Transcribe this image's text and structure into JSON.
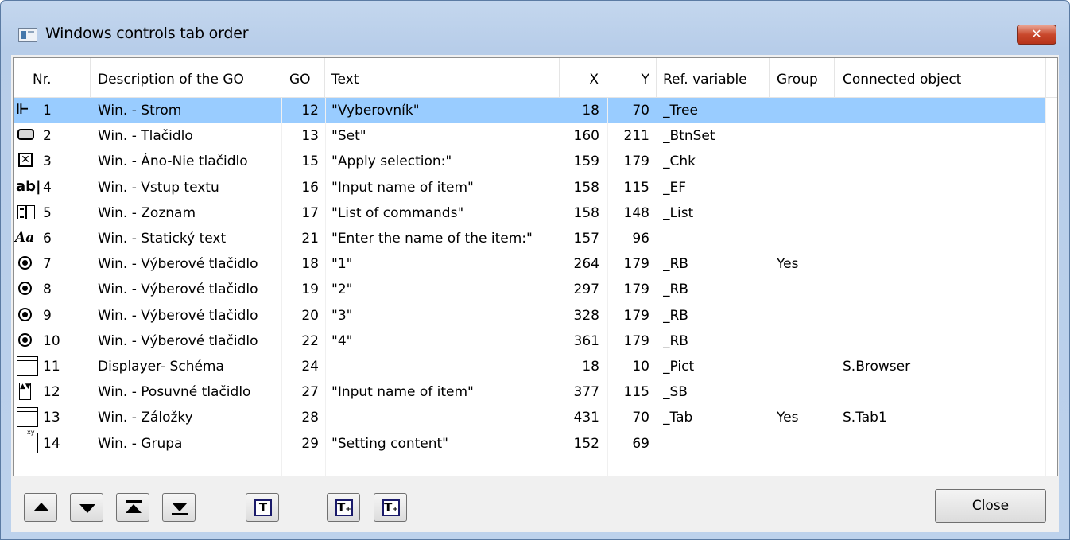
{
  "window": {
    "title": "Windows controls tab order",
    "close_glyph": "x"
  },
  "columns": {
    "nr": "Nr.",
    "desc": "Description of the GO",
    "go": "GO",
    "text": "Text",
    "x": "X",
    "y": "Y",
    "ref": "Ref. variable",
    "group": "Group",
    "conn": "Connected object"
  },
  "rows": [
    {
      "icon": "tree-icon",
      "nr": "1",
      "desc": "Win. - Strom",
      "go": "12",
      "text": "\"Vyberovník\"",
      "x": "18",
      "y": "70",
      "ref": "_Tree",
      "group": "",
      "conn": "",
      "selected": true
    },
    {
      "icon": "button-icon",
      "nr": "2",
      "desc": "Win. - Tlačidlo",
      "go": "13",
      "text": "\"Set\"",
      "x": "160",
      "y": "211",
      "ref": "_BtnSet",
      "group": "",
      "conn": ""
    },
    {
      "icon": "checkbox-icon",
      "nr": "3",
      "desc": "Win. - Áno-Nie tlačidlo",
      "go": "15",
      "text": "\"Apply selection:\"",
      "x": "159",
      "y": "179",
      "ref": "_Chk",
      "group": "",
      "conn": ""
    },
    {
      "icon": "text-input-icon",
      "nr": "4",
      "desc": "Win. - Vstup textu",
      "go": "16",
      "text": "\"Input name of item\"",
      "x": "158",
      "y": "115",
      "ref": "_EF",
      "group": "",
      "conn": ""
    },
    {
      "icon": "list-icon",
      "nr": "5",
      "desc": "Win. - Zoznam",
      "go": "17",
      "text": "\"List of commands\"",
      "x": "158",
      "y": "148",
      "ref": "_List",
      "group": "",
      "conn": ""
    },
    {
      "icon": "static-text-icon",
      "nr": "6",
      "desc": "Win. - Statický text",
      "go": "21",
      "text": "\"Enter the name of the item:\"",
      "x": "157",
      "y": "96",
      "ref": "",
      "group": "",
      "conn": ""
    },
    {
      "icon": "radio-icon",
      "nr": "7",
      "desc": "Win. - Výberové tlačidlo",
      "go": "18",
      "text": "\"1\"",
      "x": "264",
      "y": "179",
      "ref": "_RB",
      "group": "Yes",
      "conn": ""
    },
    {
      "icon": "radio-icon",
      "nr": "8",
      "desc": "Win. - Výberové tlačidlo",
      "go": "19",
      "text": "\"2\"",
      "x": "297",
      "y": "179",
      "ref": "_RB",
      "group": "",
      "conn": ""
    },
    {
      "icon": "radio-icon",
      "nr": "9",
      "desc": "Win. - Výberové tlačidlo",
      "go": "20",
      "text": "\"3\"",
      "x": "328",
      "y": "179",
      "ref": "_RB",
      "group": "",
      "conn": ""
    },
    {
      "icon": "radio-icon",
      "nr": "10",
      "desc": "Win. - Výberové tlačidlo",
      "go": "22",
      "text": "\"4\"",
      "x": "361",
      "y": "179",
      "ref": "_RB",
      "group": "",
      "conn": ""
    },
    {
      "icon": "frame-icon",
      "nr": "11",
      "desc": "Displayer- Schéma",
      "go": "24",
      "text": "",
      "x": "18",
      "y": "10",
      "ref": "_Pict",
      "group": "",
      "conn": "S.Browser"
    },
    {
      "icon": "spin-button-icon",
      "nr": "12",
      "desc": "Win. - Posuvné tlačidlo",
      "go": "27",
      "text": "\"Input name of item\"",
      "x": "377",
      "y": "115",
      "ref": "_SB",
      "group": "",
      "conn": ""
    },
    {
      "icon": "frame-icon",
      "nr": "13",
      "desc": "Win. - Záložky",
      "go": "28",
      "text": "",
      "x": "431",
      "y": "70",
      "ref": "_Tab",
      "group": "Yes",
      "conn": "S.Tab1"
    },
    {
      "icon": "group-box-icon",
      "nr": "14",
      "desc": "Win. - Grupa",
      "go": "29",
      "text": "\"Setting content\"",
      "x": "152",
      "y": "69",
      "ref": "",
      "group": "",
      "conn": ""
    }
  ],
  "group_icon_text": "xy",
  "toolbar": {
    "buttons": [
      {
        "name": "move-up-button",
        "icon": "arrow-up-icon"
      },
      {
        "name": "move-down-button",
        "icon": "arrow-down-icon"
      },
      {
        "name": "move-to-top-button",
        "icon": "arrow-top-icon"
      },
      {
        "name": "move-to-bottom-button",
        "icon": "arrow-bottom-icon"
      },
      {
        "name": "tab-order-button",
        "icon": "tab-order-icon",
        "glyph": "T"
      },
      {
        "name": "tab-order-add-button",
        "icon": "tab-order-add-icon",
        "glyph": "T",
        "sub": "+"
      },
      {
        "name": "tab-order-insert-button",
        "icon": "tab-order-insert-icon",
        "glyph": "T",
        "sub": "+"
      }
    ],
    "close_label_mnemonic": "C",
    "close_label_rest": "lose"
  }
}
